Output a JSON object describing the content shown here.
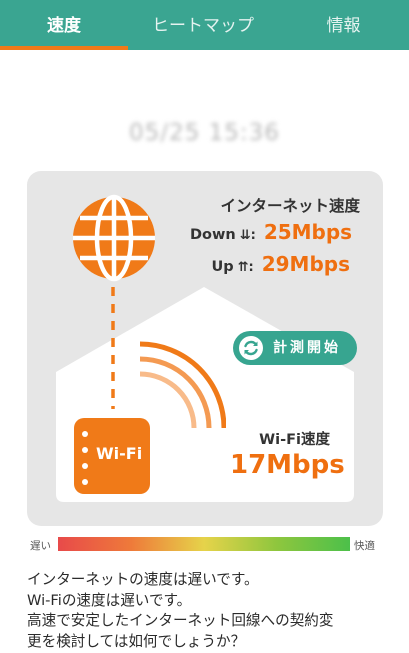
{
  "tabs": [
    {
      "label": "速度",
      "active": true
    },
    {
      "label": "ヒートマップ",
      "active": false
    },
    {
      "label": "情報",
      "active": false
    }
  ],
  "timestamp": "05/25 15:36",
  "internet": {
    "title": "インターネット速度",
    "down_label": "Down",
    "down_arrow": "⇊:",
    "down_value": "25Mbps",
    "up_label": "Up",
    "up_arrow": "⇈:",
    "up_value": "29Mbps"
  },
  "measure_button": {
    "label": "計測開始"
  },
  "router": {
    "label": "Wi-Fi"
  },
  "wifi": {
    "title": "Wi-Fi速度",
    "value": "17Mbps"
  },
  "scale": {
    "slow_label": "遅い",
    "fast_label": "快適"
  },
  "message": [
    "インターネットの速度は遅いです。",
    "Wi-Fiの速度は遅いです。",
    "高速で安定したインターネット回線への契約変",
    "更を検討しては如何でしょうか？"
  ],
  "colors": {
    "accent_teal": "#3aa591",
    "accent_orange": "#f07a18",
    "card_gray": "#e6e6e6"
  }
}
